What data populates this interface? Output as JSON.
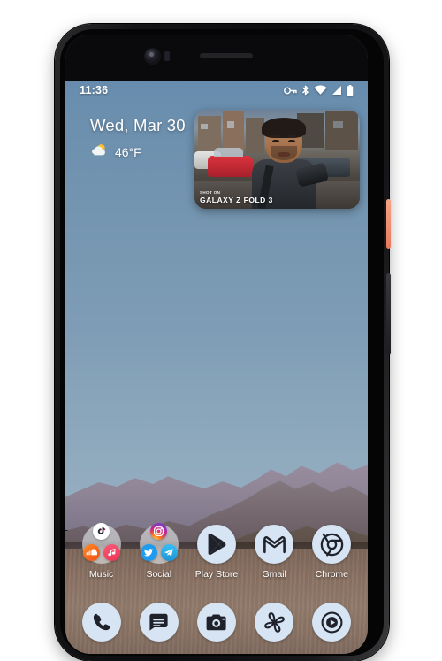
{
  "device": {
    "name": "android-phone",
    "notch_elements": [
      "front-camera",
      "earpiece-speaker"
    ],
    "side_buttons": [
      "power-button",
      "volume-button"
    ],
    "power_button_color": "#f09070"
  },
  "status_bar": {
    "time": "11:36",
    "icons": [
      "vpn-key-icon",
      "bluetooth-icon",
      "wifi-icon",
      "cellular-signal-icon",
      "battery-icon"
    ]
  },
  "widget": {
    "date": "Wed, Mar 30",
    "weather_icon": "partly-cloudy-icon",
    "temperature": "46°F"
  },
  "pip": {
    "name": "picture-in-picture-video",
    "overlay_small": "SHOT ON",
    "overlay_brand": "GALAXY Z FOLD 3"
  },
  "apps": [
    {
      "label": "Music",
      "icon": "music-folder-icon",
      "type": "folder",
      "contents": [
        "tiktok-icon",
        "soundcloud-icon",
        "music-note-icon"
      ]
    },
    {
      "label": "Social",
      "icon": "social-folder-icon",
      "type": "folder",
      "contents": [
        "instagram-icon",
        "twitter-icon",
        "telegram-icon"
      ]
    },
    {
      "label": "Play Store",
      "icon": "play-store-icon",
      "type": "app",
      "contents": []
    },
    {
      "label": "Gmail",
      "icon": "gmail-icon",
      "type": "app",
      "contents": []
    },
    {
      "label": "Chrome",
      "icon": "chrome-icon",
      "type": "app",
      "contents": []
    }
  ],
  "dock": [
    {
      "name": "phone-icon"
    },
    {
      "name": "messages-icon"
    },
    {
      "name": "camera-icon"
    },
    {
      "name": "pinwheel-photos-icon"
    },
    {
      "name": "media-play-icon"
    }
  ],
  "colors": {
    "sky": "#7596b1",
    "desert": "#8a7263",
    "icon_bg": "#d6e4f3",
    "accent": "#1d9bf0"
  }
}
